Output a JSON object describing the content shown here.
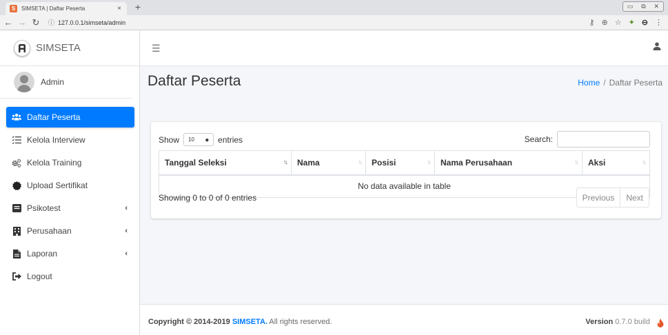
{
  "browser": {
    "tab_title": "SIMSETA | Daftar Peserta",
    "favicon_letter": "S",
    "url": "127.0.0.1/simseta/admin"
  },
  "sidebar": {
    "brand": "SIMSETA",
    "user": "Admin",
    "items": [
      {
        "label": "Daftar Peserta",
        "icon": "users-icon",
        "active": true,
        "has_submenu": false
      },
      {
        "label": "Kelola Interview",
        "icon": "list-check-icon",
        "active": false,
        "has_submenu": false
      },
      {
        "label": "Kelola Training",
        "icon": "cogs-icon",
        "active": false,
        "has_submenu": false
      },
      {
        "label": "Upload Sertifikat",
        "icon": "certificate-icon",
        "active": false,
        "has_submenu": false
      },
      {
        "label": "Psikotest",
        "icon": "psikotest-icon",
        "active": false,
        "has_submenu": true
      },
      {
        "label": "Perusahaan",
        "icon": "building-icon",
        "active": false,
        "has_submenu": true
      },
      {
        "label": "Laporan",
        "icon": "file-icon",
        "active": false,
        "has_submenu": true
      },
      {
        "label": "Logout",
        "icon": "sign-out-icon",
        "active": false,
        "has_submenu": false
      }
    ]
  },
  "header": {
    "title": "Daftar Peserta",
    "breadcrumb_home": "Home",
    "breadcrumb_current": "Daftar Peserta"
  },
  "table_controls": {
    "show_label": "Show",
    "entries_value": "10",
    "entries_label": "entries",
    "search_label": "Search:"
  },
  "table": {
    "columns": [
      "Tanggal Seleksi",
      "Nama",
      "Posisi",
      "Nama Perusahaan",
      "Aksi"
    ],
    "empty_message": "No data available in table",
    "info": "Showing 0 to 0 of 0 entries",
    "previous": "Previous",
    "next": "Next"
  },
  "footer": {
    "copyright_prefix": "Copyright © 2014-2019 ",
    "brand": "SIMSETA.",
    "copyright_suffix": " All rights reserved.",
    "version_label": "Version",
    "version_value": " 0.7.0 build"
  },
  "colors": {
    "accent": "#007bff",
    "content_bg": "#f4f6f9"
  }
}
